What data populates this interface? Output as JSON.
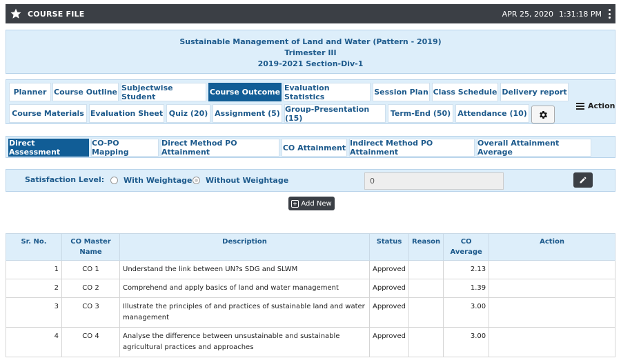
{
  "topbar": {
    "title": "COURSE FILE",
    "date": "APR 25, 2020",
    "time": "1:31:18 PM"
  },
  "header": {
    "course": "Sustainable Management of Land and Water (Pattern - 2019)",
    "term": "Trimester III",
    "section": "2019-2021 Section-Div-1"
  },
  "tabs": {
    "planner": "Planner",
    "course_outline": "Course Outline",
    "subjectwise_student": "Subjectwise Student",
    "course_outcome": "Course Outcome",
    "evaluation_statistics": "Evaluation Statistics",
    "session_plan": "Session Plan",
    "class_schedule": "Class Schedule",
    "delivery_report": "Delivery report",
    "course_materials": "Course Materials",
    "evaluation_sheet": "Evaluation Sheet",
    "quiz": "Quiz (20)",
    "assignment": "Assignment (5)",
    "group_presentation": "Group-Presentation (15)",
    "term_end": "Term-End (50)",
    "attendance": "Attendance (10)",
    "action": "Action"
  },
  "subtabs": {
    "direct_assessment": "Direct Assessment",
    "co_po_mapping": "CO-PO Mapping",
    "direct_method": "Direct Method PO Attainment",
    "co_attainment": "CO Attainment",
    "indirect_method": "Indirect Method PO Attainment",
    "overall": "Overall Attainment Average"
  },
  "satisfaction": {
    "label": "Satisfaction Level:",
    "with_weightage": "With Weightage",
    "without_weightage": "Without Weightage",
    "value": "0"
  },
  "add_new": "Add New",
  "table": {
    "headers": {
      "sr": "Sr. No.",
      "co_master": "CO Master Name",
      "description": "Description",
      "status": "Status",
      "reason": "Reason",
      "co_average": "CO Average",
      "action": "Action"
    },
    "rows": [
      {
        "sr": "1",
        "name": "CO 1",
        "description": "Understand the link between UN?s SDG and SLWM",
        "status": "Approved",
        "reason": "",
        "avg": "2.13"
      },
      {
        "sr": "2",
        "name": "CO 2",
        "description": "Comprehend and apply basics of land and water management",
        "status": "Approved",
        "reason": "",
        "avg": "1.39"
      },
      {
        "sr": "3",
        "name": "CO 3",
        "description": "Illustrate the principles of and practices of sustainable land and water management",
        "status": "Approved",
        "reason": "",
        "avg": "3.00"
      },
      {
        "sr": "4",
        "name": "CO 4",
        "description": "Analyse the difference between unsustainable and sustainable agricultural practices and approaches",
        "status": "Approved",
        "reason": "",
        "avg": "3.00"
      }
    ]
  },
  "colors": {
    "dark": "#3b3f45",
    "panel": "#ddeefa",
    "accent": "#115d96",
    "label": "#1d5a8c"
  },
  "icons": {
    "star": "star-icon",
    "menu": "kebab-menu-icon",
    "gear": "gear-icon",
    "hamburger": "hamburger-icon",
    "pencil": "pencil-icon",
    "plus": "plus-icon"
  }
}
